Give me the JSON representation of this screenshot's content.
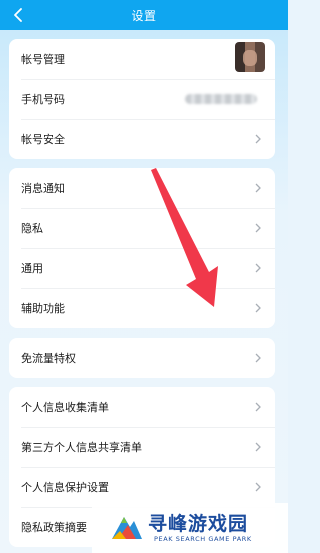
{
  "header": {
    "title": "设置"
  },
  "groups": [
    {
      "items": [
        {
          "label": "帐号管理"
        },
        {
          "label": "手机号码"
        },
        {
          "label": "帐号安全"
        }
      ]
    },
    {
      "items": [
        {
          "label": "消息通知"
        },
        {
          "label": "隐私"
        },
        {
          "label": "通用"
        },
        {
          "label": "辅助功能"
        }
      ]
    },
    {
      "items": [
        {
          "label": "免流量特权"
        }
      ]
    },
    {
      "items": [
        {
          "label": "个人信息收集清单"
        },
        {
          "label": "第三方个人信息共享清单"
        },
        {
          "label": "个人信息保护设置"
        },
        {
          "label": "隐私政策摘要"
        }
      ]
    }
  ],
  "watermark": {
    "text_cn": "寻峰游戏园",
    "text_en": "PEAK SEARCH GAME PARK"
  },
  "colors": {
    "header_bg": "#0fa6f0",
    "page_bg": "#e9f4fc",
    "annotation_arrow": "#f0384a",
    "watermark_text": "#1d4d9e"
  },
  "icons": {
    "back": "chevron-left-icon",
    "row_chevron": "chevron-right-icon"
  }
}
